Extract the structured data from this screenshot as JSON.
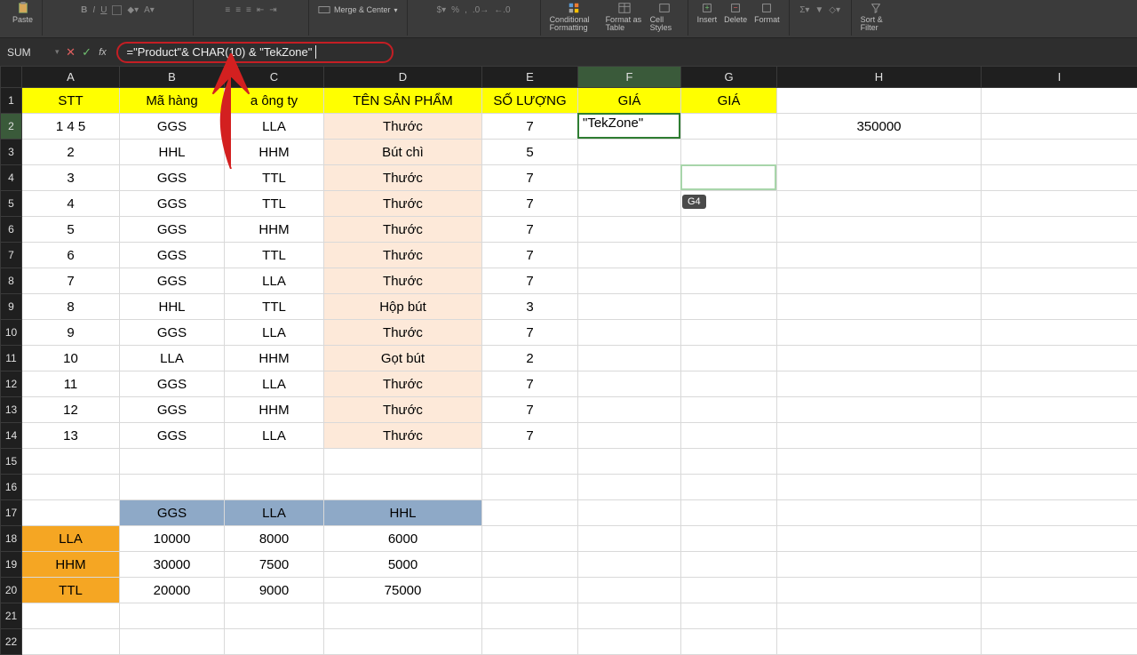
{
  "ribbon": {
    "paste": "Paste",
    "merge": "Merge & Center",
    "cond_fmt": "Conditional Formatting",
    "fmt_table": "Format as Table",
    "cell_styles": "Cell Styles",
    "insert": "Insert",
    "delete": "Delete",
    "format": "Format",
    "sort": "Sort & Filter"
  },
  "formula_bar": {
    "name_box": "SUM",
    "fx_label": "fx",
    "formula": "=\"Product\"& CHAR(10) & \"TekZone\""
  },
  "columns": [
    "A",
    "B",
    "C",
    "D",
    "E",
    "F",
    "G",
    "H",
    "I"
  ],
  "headers": {
    "A": "STT",
    "B": "Mã hàng",
    "C": "a ông ty",
    "D": "TÊN SẢN PHẨM",
    "E": "SỐ LƯỢNG",
    "F": "GIÁ",
    "G": "GIÁ"
  },
  "rows": [
    {
      "A": "1 4 5",
      "B": "GGS",
      "C": "LLA",
      "D": "Thước",
      "E": "7",
      "F": "\"TekZone\"",
      "H": "350000"
    },
    {
      "A": "2",
      "B": "HHL",
      "C": "HHM",
      "D": "Bút chì",
      "E": "5"
    },
    {
      "A": "3",
      "B": "GGS",
      "C": "TTL",
      "D": "Thước",
      "E": "7"
    },
    {
      "A": "4",
      "B": "GGS",
      "C": "TTL",
      "D": "Thước",
      "E": "7"
    },
    {
      "A": "5",
      "B": "GGS",
      "C": "HHM",
      "D": "Thước",
      "E": "7"
    },
    {
      "A": "6",
      "B": "GGS",
      "C": "TTL",
      "D": "Thước",
      "E": "7"
    },
    {
      "A": "7",
      "B": "GGS",
      "C": "LLA",
      "D": "Thước",
      "E": "7"
    },
    {
      "A": "8",
      "B": "HHL",
      "C": "TTL",
      "D": "Hộp bút",
      "E": "3"
    },
    {
      "A": "9",
      "B": "GGS",
      "C": "LLA",
      "D": "Thước",
      "E": "7"
    },
    {
      "A": "10",
      "B": "LLA",
      "C": "HHM",
      "D": "Gọt bút",
      "E": "2"
    },
    {
      "A": "11",
      "B": "GGS",
      "C": "LLA",
      "D": "Thước",
      "E": "7"
    },
    {
      "A": "12",
      "B": "GGS",
      "C": "HHM",
      "D": "Thước",
      "E": "7"
    },
    {
      "A": "13",
      "B": "GGS",
      "C": "LLA",
      "D": "Thước",
      "E": "7"
    }
  ],
  "lookup": {
    "cols": [
      "GGS",
      "LLA",
      "HHL"
    ],
    "rows": [
      {
        "label": "LLA",
        "v": [
          "10000",
          "8000",
          "6000"
        ]
      },
      {
        "label": "HHM",
        "v": [
          "30000",
          "7500",
          "5000"
        ]
      },
      {
        "label": "TTL",
        "v": [
          "20000",
          "9000",
          "75000"
        ]
      }
    ]
  },
  "tooltip": "G4",
  "active_cell_value": "\"TekZone\""
}
